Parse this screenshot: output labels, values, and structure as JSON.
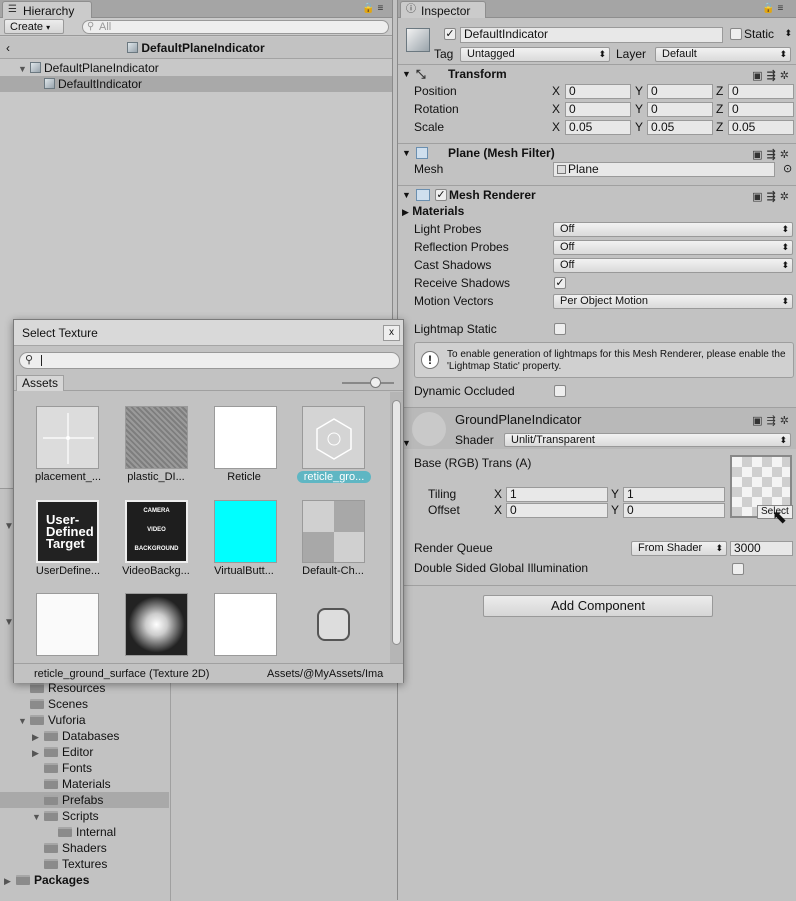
{
  "hierarchy": {
    "tab_label": "Hierarchy",
    "create_label": "Create",
    "search_placeholder": "All",
    "scene_title": "DefaultPlaneIndicator",
    "tree": [
      {
        "label": "DefaultPlaneIndicator"
      },
      {
        "label": "DefaultIndicator"
      }
    ]
  },
  "project": {
    "items": [
      {
        "label": "Resources"
      },
      {
        "label": "Scenes"
      },
      {
        "label": "Vuforia"
      },
      {
        "label": "Databases"
      },
      {
        "label": "Editor"
      },
      {
        "label": "Fonts"
      },
      {
        "label": "Materials"
      },
      {
        "label": "Prefabs"
      },
      {
        "label": "Scripts"
      },
      {
        "label": "Internal"
      },
      {
        "label": "Shaders"
      },
      {
        "label": "Textures"
      },
      {
        "label": "Packages"
      }
    ]
  },
  "inspector": {
    "tab_label": "Inspector",
    "object_name": "DefaultIndicator",
    "static_label": "Static",
    "tag_label": "Tag",
    "tag_value": "Untagged",
    "layer_label": "Layer",
    "layer_value": "Default",
    "transform": {
      "title": "Transform",
      "position_label": "Position",
      "rotation_label": "Rotation",
      "scale_label": "Scale",
      "x": "X",
      "y": "Y",
      "z": "Z",
      "position": [
        "0",
        "0",
        "0"
      ],
      "rotation": [
        "0",
        "0",
        "0"
      ],
      "scale": [
        "0.05",
        "0.05",
        "0.05"
      ]
    },
    "mesh_filter": {
      "title": "Plane (Mesh Filter)",
      "mesh_label": "Mesh",
      "mesh_value": "Plane"
    },
    "mesh_renderer": {
      "title": "Mesh Renderer",
      "materials_label": "Materials",
      "light_probes_label": "Light Probes",
      "light_probes_value": "Off",
      "reflection_probes_label": "Reflection Probes",
      "reflection_probes_value": "Off",
      "cast_shadows_label": "Cast Shadows",
      "cast_shadows_value": "Off",
      "receive_shadows_label": "Receive Shadows",
      "motion_vectors_label": "Motion Vectors",
      "motion_vectors_value": "Per Object Motion",
      "lightmap_static_label": "Lightmap Static",
      "info_text": "To enable generation of lightmaps for this Mesh Renderer, please enable the 'Lightmap Static' property.",
      "dynamic_occluded_label": "Dynamic Occluded"
    },
    "material": {
      "title": "GroundPlaneIndicator",
      "shader_label": "Shader",
      "shader_value": "Unlit/Transparent",
      "base_label": "Base (RGB) Trans (A)",
      "tiling_label": "Tiling",
      "offset_label": "Offset",
      "x": "X",
      "y": "Y",
      "tiling": [
        "1",
        "1"
      ],
      "offset": [
        "0",
        "0"
      ],
      "select_label": "Select",
      "render_queue_label": "Render Queue",
      "render_queue_mode": "From Shader",
      "render_queue_value": "3000",
      "dsgi_label": "Double Sided Global Illumination"
    },
    "add_component_label": "Add Component"
  },
  "select_texture": {
    "title": "Select Texture",
    "close_label": "x",
    "assets_tab": "Assets",
    "items": [
      {
        "label": "placement_..."
      },
      {
        "label": "plastic_DI..."
      },
      {
        "label": "Reticle"
      },
      {
        "label": "reticle_gro..."
      },
      {
        "label": "UserDefine..."
      },
      {
        "label": "VideoBackg..."
      },
      {
        "label": "VirtualButt..."
      },
      {
        "label": "Default-Ch..."
      }
    ],
    "udt_text": "User-Defined Target",
    "video_text": [
      "CAMERA",
      "VIDEO",
      "BACKGROUND"
    ],
    "status_name": "reticle_ground_surface (Texture 2D)",
    "status_path": "Assets/@MyAssets/Ima",
    "selection_color": "#5fb6c3"
  }
}
